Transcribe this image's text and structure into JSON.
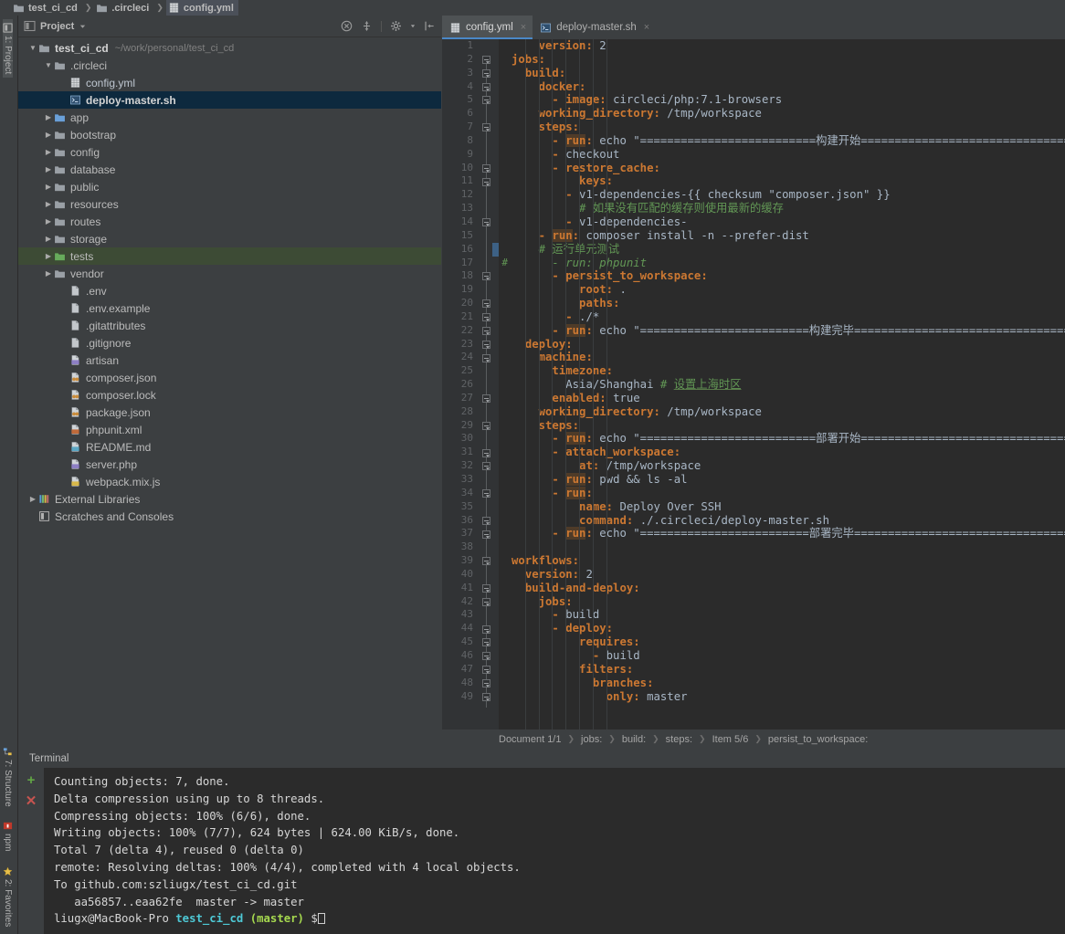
{
  "navbar": {
    "crumbs": [
      {
        "label": "test_ci_cd",
        "icon": "folder-icon"
      },
      {
        "label": ".circleci",
        "icon": "folder-icon"
      },
      {
        "label": "config.yml",
        "icon": "yaml-file-icon"
      }
    ]
  },
  "rail": {
    "top": [
      {
        "label": "1: Project",
        "icon": "project-icon"
      }
    ],
    "bottom": [
      {
        "label": "2: Favorites",
        "icon": "star-icon"
      },
      {
        "label": "npm",
        "icon": "npm-icon"
      },
      {
        "label": "7: Structure",
        "icon": "structure-icon"
      }
    ]
  },
  "project": {
    "title": "Project",
    "tools": [
      "collapse-all-icon",
      "scroll-from-source-icon",
      "settings-gear-icon",
      "hide-panel-icon"
    ],
    "tree": [
      {
        "label": "test_ci_cd",
        "path": "~/work/personal/test_ci_cd",
        "icon": "folder-icon",
        "indent": 0,
        "arrow": "down",
        "bold": true
      },
      {
        "label": ".circleci",
        "icon": "folder-icon",
        "indent": 1,
        "arrow": "down"
      },
      {
        "label": "config.yml",
        "icon": "yaml-file-icon",
        "indent": 2,
        "arrow": "none",
        "yml": true
      },
      {
        "label": "deploy-master.sh",
        "icon": "shell-file-icon",
        "indent": 2,
        "arrow": "none",
        "state": "selected",
        "bold": true
      },
      {
        "label": "app",
        "icon": "folder-blue-icon",
        "indent": 1,
        "arrow": "right"
      },
      {
        "label": "bootstrap",
        "icon": "folder-icon",
        "indent": 1,
        "arrow": "right"
      },
      {
        "label": "config",
        "icon": "folder-icon",
        "indent": 1,
        "arrow": "right"
      },
      {
        "label": "database",
        "icon": "folder-icon",
        "indent": 1,
        "arrow": "right"
      },
      {
        "label": "public",
        "icon": "folder-icon",
        "indent": 1,
        "arrow": "right"
      },
      {
        "label": "resources",
        "icon": "folder-icon",
        "indent": 1,
        "arrow": "right"
      },
      {
        "label": "routes",
        "icon": "folder-icon",
        "indent": 1,
        "arrow": "right"
      },
      {
        "label": "storage",
        "icon": "folder-icon",
        "indent": 1,
        "arrow": "right"
      },
      {
        "label": "tests",
        "icon": "folder-green-icon",
        "indent": 1,
        "arrow": "right",
        "state": "highlighted"
      },
      {
        "label": "vendor",
        "icon": "folder-icon",
        "indent": 1,
        "arrow": "right"
      },
      {
        "label": ".env",
        "icon": "file-icon",
        "indent": 2,
        "arrow": "none"
      },
      {
        "label": ".env.example",
        "icon": "file-icon",
        "indent": 2,
        "arrow": "none"
      },
      {
        "label": ".gitattributes",
        "icon": "file-icon",
        "indent": 2,
        "arrow": "none"
      },
      {
        "label": ".gitignore",
        "icon": "file-icon",
        "indent": 2,
        "arrow": "none"
      },
      {
        "label": "artisan",
        "icon": "php-file-icon",
        "indent": 2,
        "arrow": "none"
      },
      {
        "label": "composer.json",
        "icon": "json-file-icon",
        "indent": 2,
        "arrow": "none"
      },
      {
        "label": "composer.lock",
        "icon": "json-file-icon",
        "indent": 2,
        "arrow": "none"
      },
      {
        "label": "package.json",
        "icon": "json-file-icon",
        "indent": 2,
        "arrow": "none"
      },
      {
        "label": "phpunit.xml",
        "icon": "xml-file-icon",
        "indent": 2,
        "arrow": "none"
      },
      {
        "label": "README.md",
        "icon": "markdown-file-icon",
        "indent": 2,
        "arrow": "none"
      },
      {
        "label": "server.php",
        "icon": "php-file-icon",
        "indent": 2,
        "arrow": "none"
      },
      {
        "label": "webpack.mix.js",
        "icon": "js-file-icon",
        "indent": 2,
        "arrow": "none"
      },
      {
        "label": "External Libraries",
        "icon": "libraries-icon",
        "indent": 0,
        "arrow": "right"
      },
      {
        "label": "Scratches and Consoles",
        "icon": "scratches-icon",
        "indent": 0,
        "arrow": "none"
      }
    ]
  },
  "editor": {
    "tabs": [
      {
        "label": "config.yml",
        "icon": "yaml-file-icon",
        "active": true,
        "close": "×"
      },
      {
        "label": "deploy-master.sh",
        "icon": "shell-file-icon",
        "active": false,
        "close": "×"
      }
    ],
    "language": "yaml",
    "first_line": 1,
    "last_line": 49,
    "lines": [
      {
        "n": 1,
        "indent": 2,
        "tokens": [
          {
            "t": "version",
            "c": "k"
          },
          {
            "t": ": ",
            "c": "k"
          },
          {
            "t": "2",
            "c": "v"
          }
        ]
      },
      {
        "n": 2,
        "indent": 0,
        "fold": "minus",
        "tokens": [
          {
            "t": "jobs:",
            "c": "k"
          }
        ]
      },
      {
        "n": 3,
        "indent": 1,
        "fold": "minus",
        "tokens": [
          {
            "t": "build:",
            "c": "k"
          }
        ]
      },
      {
        "n": 4,
        "indent": 2,
        "fold": "minus",
        "tokens": [
          {
            "t": "docker:",
            "c": "k"
          }
        ]
      },
      {
        "n": 5,
        "indent": 3,
        "fold": "minus",
        "tokens": [
          {
            "t": "- ",
            "c": "d"
          },
          {
            "t": "image",
            "c": "k"
          },
          {
            "t": ": ",
            "c": "k"
          },
          {
            "t": "circleci/php:7.1-browsers",
            "c": "v"
          }
        ]
      },
      {
        "n": 6,
        "indent": 2,
        "tokens": [
          {
            "t": "working_directory",
            "c": "k"
          },
          {
            "t": ": ",
            "c": "k"
          },
          {
            "t": "/tmp/workspace",
            "c": "v"
          }
        ]
      },
      {
        "n": 7,
        "indent": 2,
        "fold": "minus",
        "tokens": [
          {
            "t": "steps:",
            "c": "k"
          }
        ]
      },
      {
        "n": 8,
        "indent": 3,
        "tokens": [
          {
            "t": "- ",
            "c": "d"
          },
          {
            "t": "run",
            "c": "kb"
          },
          {
            "t": ": ",
            "c": "k"
          },
          {
            "t": "echo \"==========================构建开始=================================\"",
            "c": "v"
          }
        ]
      },
      {
        "n": 9,
        "indent": 3,
        "tokens": [
          {
            "t": "- ",
            "c": "d"
          },
          {
            "t": "checkout",
            "c": "v"
          }
        ]
      },
      {
        "n": 10,
        "indent": 3,
        "fold": "minus",
        "tokens": [
          {
            "t": "- ",
            "c": "d"
          },
          {
            "t": "restore_cache",
            "c": "k"
          },
          {
            "t": ":",
            "c": "k"
          }
        ]
      },
      {
        "n": 11,
        "indent": 5,
        "fold": "minus",
        "tokens": [
          {
            "t": "keys",
            "c": "k"
          },
          {
            "t": ":",
            "c": "k"
          }
        ]
      },
      {
        "n": 12,
        "indent": 4,
        "tokens": [
          {
            "t": "- ",
            "c": "d"
          },
          {
            "t": "v1-dependencies-{{ checksum \"composer.json\" }}",
            "c": "v"
          }
        ]
      },
      {
        "n": 13,
        "indent": 5,
        "tokens": [
          {
            "t": "# 如果没有匹配的缓存则使用最新的缓存",
            "c": "cm"
          }
        ]
      },
      {
        "n": 14,
        "indent": 4,
        "fold": "minus",
        "tokens": [
          {
            "t": "- ",
            "c": "d"
          },
          {
            "t": "v1-dependencies-",
            "c": "v"
          }
        ]
      },
      {
        "n": 15,
        "indent": 2,
        "tokens": [
          {
            "t": "- ",
            "c": "d"
          },
          {
            "t": "run",
            "c": "kb"
          },
          {
            "t": ": ",
            "c": "k"
          },
          {
            "t": "composer install -n --prefer-dist",
            "c": "v"
          }
        ]
      },
      {
        "n": 16,
        "indent": 2,
        "marker": "blue",
        "tokens": [
          {
            "t": "# 运行单元测试",
            "c": "cm"
          }
        ]
      },
      {
        "n": 17,
        "indent": 2,
        "gmark": "#",
        "tokens": [
          {
            "t": "  - run: phpunit",
            "c": "cmi"
          }
        ]
      },
      {
        "n": 18,
        "indent": 3,
        "fold": "minus",
        "tokens": [
          {
            "t": "- ",
            "c": "d"
          },
          {
            "t": "persist_to_workspace",
            "c": "k"
          },
          {
            "t": ":",
            "c": "k"
          }
        ]
      },
      {
        "n": 19,
        "indent": 5,
        "tokens": [
          {
            "t": "root",
            "c": "k"
          },
          {
            "t": ": ",
            "c": "k"
          },
          {
            "t": ".",
            "c": "v"
          }
        ]
      },
      {
        "n": 20,
        "indent": 5,
        "fold": "minus",
        "tokens": [
          {
            "t": "paths",
            "c": "k"
          },
          {
            "t": ":",
            "c": "k"
          }
        ]
      },
      {
        "n": 21,
        "indent": 4,
        "fold": "minus",
        "tokens": [
          {
            "t": "- ",
            "c": "d"
          },
          {
            "t": "./*",
            "c": "v"
          }
        ]
      },
      {
        "n": 22,
        "indent": 3,
        "fold": "minus",
        "tokens": [
          {
            "t": "- ",
            "c": "d"
          },
          {
            "t": "run",
            "c": "kb"
          },
          {
            "t": ": ",
            "c": "k"
          },
          {
            "t": "echo \"=========================构建完毕=================================\"",
            "c": "v"
          }
        ]
      },
      {
        "n": 23,
        "indent": 1,
        "fold": "minus",
        "tokens": [
          {
            "t": "deploy:",
            "c": "k"
          }
        ]
      },
      {
        "n": 24,
        "indent": 2,
        "fold": "minus",
        "tokens": [
          {
            "t": "machine:",
            "c": "k"
          }
        ]
      },
      {
        "n": 25,
        "indent": 3,
        "tokens": [
          {
            "t": "timezone",
            "c": "k"
          },
          {
            "t": ":",
            "c": "k"
          }
        ]
      },
      {
        "n": 26,
        "indent": 4,
        "tokens": [
          {
            "t": "Asia/Shanghai ",
            "c": "v"
          },
          {
            "t": "# ",
            "c": "cm"
          },
          {
            "t": "设置上海时区",
            "c": "cmu"
          }
        ]
      },
      {
        "n": 27,
        "indent": 3,
        "fold": "minus",
        "tokens": [
          {
            "t": "enabled",
            "c": "k"
          },
          {
            "t": ": ",
            "c": "k"
          },
          {
            "t": "true",
            "c": "v"
          }
        ]
      },
      {
        "n": 28,
        "indent": 2,
        "tokens": [
          {
            "t": "working_directory",
            "c": "k"
          },
          {
            "t": ": ",
            "c": "k"
          },
          {
            "t": "/tmp/workspace",
            "c": "v"
          }
        ]
      },
      {
        "n": 29,
        "indent": 2,
        "fold": "minus",
        "tokens": [
          {
            "t": "steps:",
            "c": "k"
          }
        ]
      },
      {
        "n": 30,
        "indent": 3,
        "tokens": [
          {
            "t": "- ",
            "c": "d"
          },
          {
            "t": "run",
            "c": "kb"
          },
          {
            "t": ": ",
            "c": "k"
          },
          {
            "t": "echo \"==========================部署开始=================================\"",
            "c": "v"
          }
        ]
      },
      {
        "n": 31,
        "indent": 3,
        "fold": "minus",
        "tokens": [
          {
            "t": "- ",
            "c": "d"
          },
          {
            "t": "attach_workspace",
            "c": "k"
          },
          {
            "t": ":",
            "c": "k"
          }
        ]
      },
      {
        "n": 32,
        "indent": 5,
        "fold": "minus",
        "tokens": [
          {
            "t": "at",
            "c": "k"
          },
          {
            "t": ": ",
            "c": "k"
          },
          {
            "t": "/tmp/workspace",
            "c": "v"
          }
        ]
      },
      {
        "n": 33,
        "indent": 3,
        "tokens": [
          {
            "t": "- ",
            "c": "d"
          },
          {
            "t": "run",
            "c": "kb"
          },
          {
            "t": ": ",
            "c": "k"
          },
          {
            "t": "pwd && ls -al",
            "c": "v"
          }
        ]
      },
      {
        "n": 34,
        "indent": 3,
        "fold": "minus",
        "tokens": [
          {
            "t": "- ",
            "c": "d"
          },
          {
            "t": "run",
            "c": "kb"
          },
          {
            "t": ":",
            "c": "k"
          }
        ]
      },
      {
        "n": 35,
        "indent": 5,
        "tokens": [
          {
            "t": "name",
            "c": "k"
          },
          {
            "t": ": ",
            "c": "k"
          },
          {
            "t": "Deploy Over SSH",
            "c": "v"
          }
        ]
      },
      {
        "n": 36,
        "indent": 5,
        "fold": "minus",
        "tokens": [
          {
            "t": "command",
            "c": "k"
          },
          {
            "t": ": ",
            "c": "k"
          },
          {
            "t": "./.circleci/deploy-master.sh",
            "c": "v"
          }
        ]
      },
      {
        "n": 37,
        "indent": 3,
        "fold": "minus",
        "tokens": [
          {
            "t": "- ",
            "c": "d"
          },
          {
            "t": "run",
            "c": "kb"
          },
          {
            "t": ": ",
            "c": "k"
          },
          {
            "t": "echo \"=========================部署完毕=================================\"",
            "c": "v"
          }
        ]
      },
      {
        "n": 38,
        "indent": 0,
        "tokens": []
      },
      {
        "n": 39,
        "indent": 0,
        "fold": "minus",
        "tokens": [
          {
            "t": "workflows:",
            "c": "k"
          }
        ]
      },
      {
        "n": 40,
        "indent": 1,
        "tokens": [
          {
            "t": "version",
            "c": "k"
          },
          {
            "t": ": ",
            "c": "k"
          },
          {
            "t": "2",
            "c": "v"
          }
        ]
      },
      {
        "n": 41,
        "indent": 1,
        "fold": "minus",
        "tokens": [
          {
            "t": "build-and-deploy:",
            "c": "k"
          }
        ]
      },
      {
        "n": 42,
        "indent": 2,
        "fold": "minus",
        "tokens": [
          {
            "t": "jobs",
            "c": "k"
          },
          {
            "t": ":",
            "c": "k"
          }
        ]
      },
      {
        "n": 43,
        "indent": 3,
        "tokens": [
          {
            "t": "- ",
            "c": "d"
          },
          {
            "t": "build",
            "c": "v"
          }
        ]
      },
      {
        "n": 44,
        "indent": 3,
        "fold": "minus",
        "tokens": [
          {
            "t": "- ",
            "c": "d"
          },
          {
            "t": "deploy",
            "c": "k"
          },
          {
            "t": ":",
            "c": "k"
          }
        ]
      },
      {
        "n": 45,
        "indent": 5,
        "fold": "minus",
        "tokens": [
          {
            "t": "requires",
            "c": "k"
          },
          {
            "t": ":",
            "c": "k"
          }
        ]
      },
      {
        "n": 46,
        "indent": 6,
        "fold": "minus",
        "tokens": [
          {
            "t": "- ",
            "c": "d"
          },
          {
            "t": "build",
            "c": "v"
          }
        ]
      },
      {
        "n": 47,
        "indent": 5,
        "fold": "minus",
        "tokens": [
          {
            "t": "filters",
            "c": "k"
          },
          {
            "t": ":",
            "c": "k"
          }
        ]
      },
      {
        "n": 48,
        "indent": 6,
        "fold": "minus",
        "tokens": [
          {
            "t": "branches",
            "c": "k"
          },
          {
            "t": ":",
            "c": "k"
          }
        ]
      },
      {
        "n": 49,
        "indent": 7,
        "fold": "minus",
        "tokens": [
          {
            "t": "only",
            "c": "k"
          },
          {
            "t": ": ",
            "c": "k"
          },
          {
            "t": "master",
            "c": "v"
          }
        ]
      }
    ],
    "status_breadcrumb": [
      "Document 1/1",
      "jobs:",
      "build:",
      "steps:",
      "Item 5/6",
      "persist_to_workspace:"
    ]
  },
  "terminal": {
    "title": "Terminal",
    "side_buttons": [
      {
        "label": "+",
        "name": "new-session-button",
        "color": "#62a645"
      },
      {
        "label": "✕",
        "name": "close-session-button",
        "color": "#c75450"
      }
    ],
    "output": [
      "Counting objects: 7, done.",
      "Delta compression using up to 8 threads.",
      "Compressing objects: 100% (6/6), done.",
      "Writing objects: 100% (7/7), 624 bytes | 624.00 KiB/s, done.",
      "Total 7 (delta 4), reused 0 (delta 0)",
      "remote: Resolving deltas: 100% (4/4), completed with 4 local objects.",
      "To github.com:szliugx/test_ci_cd.git",
      "   aa56857..eaa62fe  master -> master"
    ],
    "prompt": {
      "user_host": "liugx@MacBook-Pro",
      "dir": "test_ci_cd",
      "branch": "(master)",
      "symbol": "$"
    }
  },
  "colors": {
    "accent": "#4a88c7",
    "keyword": "#cc7832",
    "comment": "#629755",
    "selection": "#0d293e",
    "highlight": "#3d4b35",
    "editor_bg": "#2b2b2b",
    "panel_bg": "#3c3f41"
  }
}
